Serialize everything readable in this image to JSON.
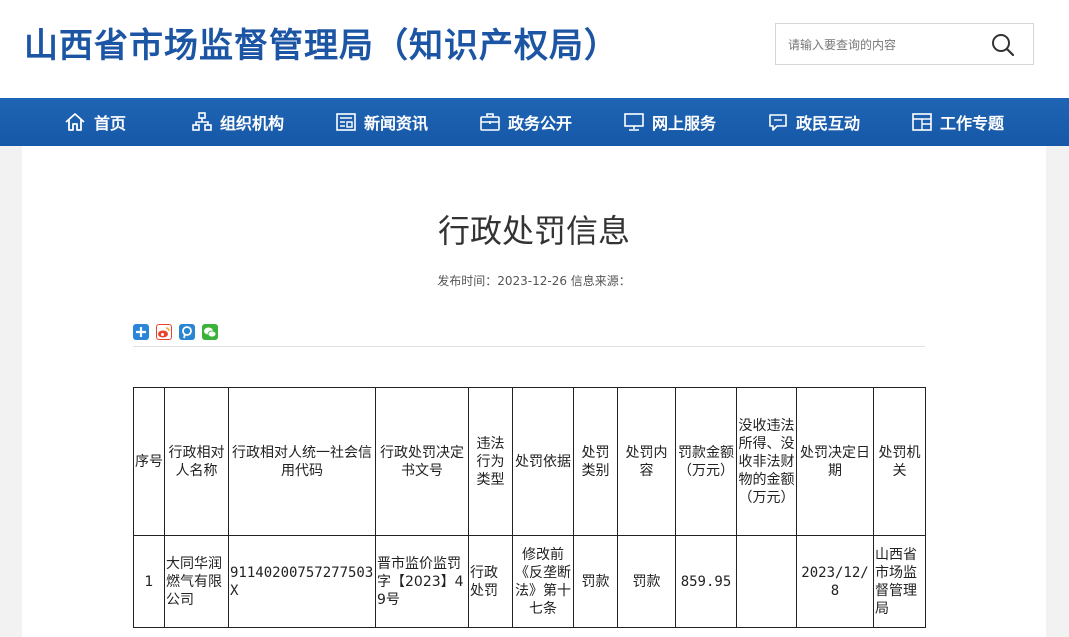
{
  "header": {
    "site_title": "山西省市场监督管理局（知识产权局）",
    "search_placeholder": "请输入要查询的内容"
  },
  "nav": {
    "items": [
      {
        "label": "首页",
        "icon": "home-icon"
      },
      {
        "label": "组织机构",
        "icon": "org-chart-icon"
      },
      {
        "label": "新闻资讯",
        "icon": "news-icon"
      },
      {
        "label": "政务公开",
        "icon": "briefcase-icon"
      },
      {
        "label": "网上服务",
        "icon": "monitor-icon"
      },
      {
        "label": "政民互动",
        "icon": "chat-icon"
      },
      {
        "label": "工作专题",
        "icon": "topic-icon"
      }
    ]
  },
  "article": {
    "title": "行政处罚信息",
    "meta": "发布时间：2023-12-26 信息来源："
  },
  "share": {
    "icons": [
      "share-more-icon",
      "weibo-icon",
      "tencent-icon",
      "wechat-icon"
    ],
    "colors": [
      "#2a86d9",
      "#e8432e",
      "#2b86d1",
      "#3bb33b"
    ]
  },
  "table": {
    "headers": [
      "序号",
      "行政相对人名称",
      "行政相对人统一社会信用代码",
      "行政处罚决定书文号",
      "违法行为类型",
      "处罚依据",
      "处罚类别",
      "处罚内容",
      "罚款金额（万元）",
      "没收违法所得、没收非法财物的金额（万元）",
      "处罚决定日期",
      "处罚机关"
    ],
    "rows": [
      [
        "1",
        "大同华润燃气有限公司",
        "91140200757277503X",
        "晋市监价监罚字【2023】49号",
        "行政处罚",
        "修改前《反垄断法》第十七条",
        "罚款",
        "罚款",
        "859.95",
        "",
        "2023/12/8",
        "山西省市场监督管理局"
      ]
    ]
  }
}
